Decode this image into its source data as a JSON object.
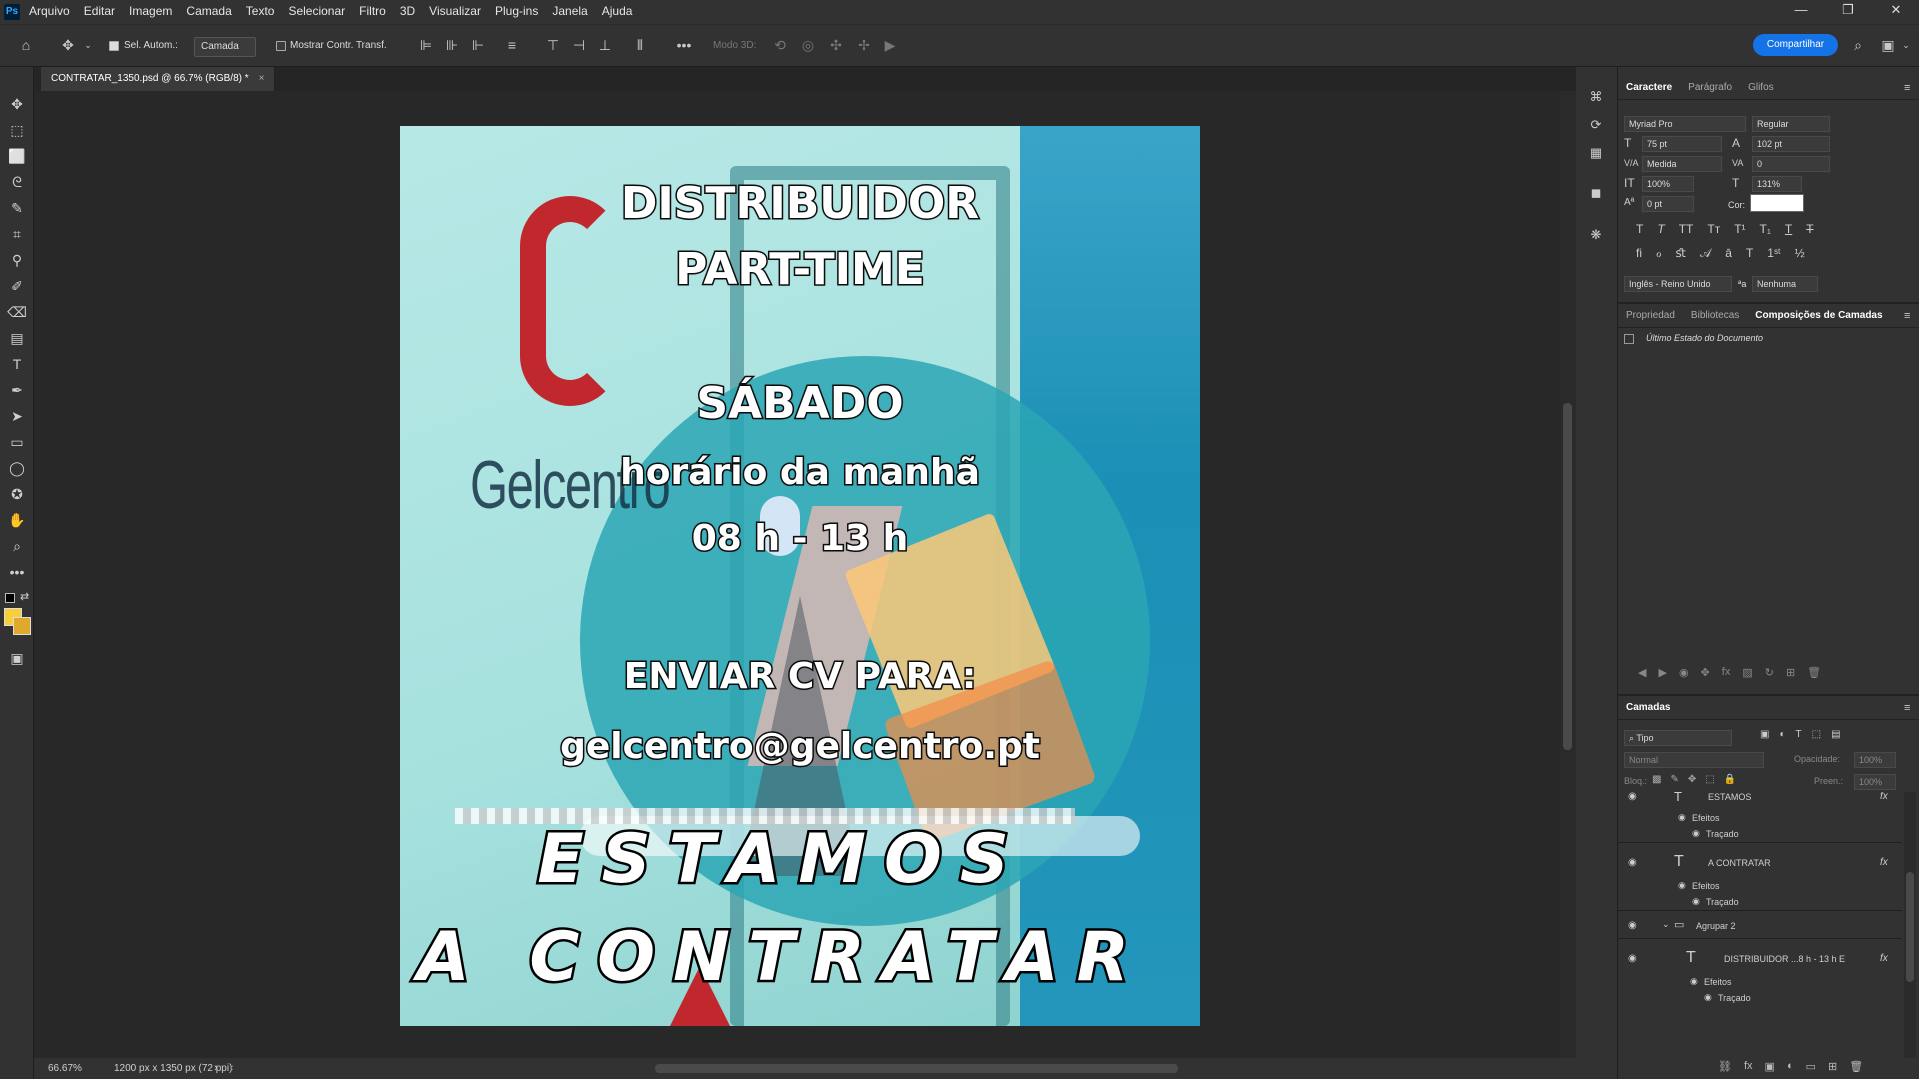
{
  "app": {
    "logo": "Ps"
  },
  "menubar": [
    "Arquivo",
    "Editar",
    "Imagem",
    "Camada",
    "Texto",
    "Selecionar",
    "Filtro",
    "3D",
    "Visualizar",
    "Plug-ins",
    "Janela",
    "Ajuda"
  ],
  "window_controls": {
    "minimize": "—",
    "maximize": "❐",
    "close": "✕"
  },
  "options": {
    "auto_select_label": "Sel. Autom.:",
    "auto_select_value": "Camada",
    "show_transform_label": "Mostrar Contr. Transf.",
    "mode3d_label": "Modo 3D:",
    "share_label": "Compartilhar"
  },
  "document": {
    "tab_title": "CONTRATAR_1350.psd @ 66.7% (RGB/8) *",
    "close": "×"
  },
  "status": {
    "zoom": "66.67%",
    "size": "1200 px x 1350 px (72 ppi)"
  },
  "poster": {
    "brand": "Gelcentro",
    "line1": "DISTRIBUIDOR",
    "line2": "PART-TIME",
    "line3": "SÁBADO",
    "line4": "horário da manhã",
    "line5": "08 h - 13 h",
    "line6": "ENVIAR CV PARA:",
    "line7": "gelcentro@gelcentro.pt",
    "line8": "ESTAMOS",
    "line9": "A CONTRATAR"
  },
  "character_panel": {
    "tabs": [
      "Caractere",
      "Parágrafo",
      "Glifos"
    ],
    "font_family": "Myriad Pro",
    "font_style": "Regular",
    "size": "75 pt",
    "leading": "102 pt",
    "kerning": "Medida",
    "tracking": "0",
    "vscale": "100%",
    "hscale": "131%",
    "baseline": "0 pt",
    "color_label": "Cor:",
    "language": "Inglês - Reino Unido",
    "aa_label": "ªa",
    "antialias": "Nenhuma",
    "color": "#ffffff"
  },
  "props_panel": {
    "tabs": [
      "Propriedad",
      "Bibliotecas",
      "Composições de Camadas"
    ],
    "item": "Último Estado do Documento"
  },
  "layers_panel": {
    "title": "Camadas",
    "filter": "Tipo",
    "blend": "Normal",
    "opacity_label": "Opacidade:",
    "opacity": "100%",
    "lock_label": "Bloq.:",
    "fill_label": "Preen.:",
    "fill": "100%",
    "layers": [
      {
        "name": "ESTAMOS",
        "kind": "T",
        "fx": "fx"
      },
      {
        "name": "Efeitos",
        "kind": "sub"
      },
      {
        "name": "Traçado",
        "kind": "sub2"
      },
      {
        "name": "A CONTRATAR",
        "kind": "T",
        "fx": "fx"
      },
      {
        "name": "Efeitos",
        "kind": "sub"
      },
      {
        "name": "Traçado",
        "kind": "sub2"
      },
      {
        "name": "Agrupar 2",
        "kind": "group"
      },
      {
        "name": "DISTRIBUIDOR ...8 h - 13 h  E",
        "kind": "T",
        "fx": "fx"
      },
      {
        "name": "Efeitos",
        "kind": "sub"
      },
      {
        "name": "Traçado",
        "kind": "sub2"
      }
    ]
  }
}
